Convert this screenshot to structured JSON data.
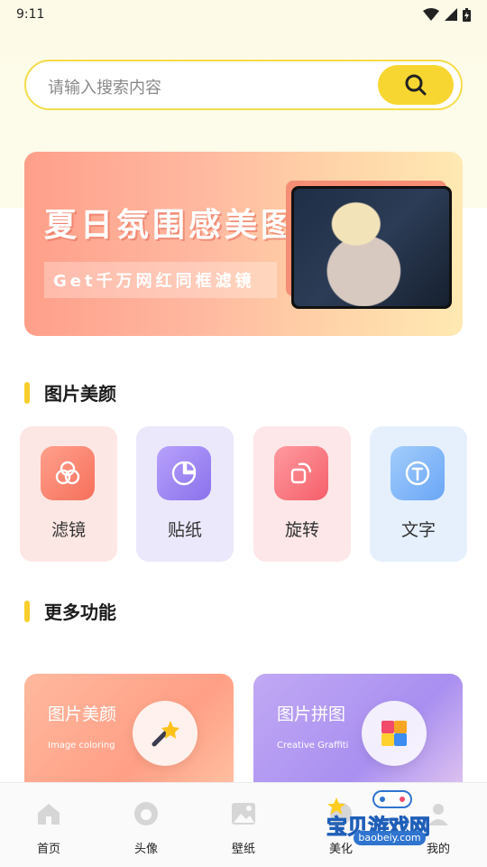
{
  "status_bar": {
    "time": "9:11"
  },
  "search": {
    "placeholder": "请输入搜索内容"
  },
  "banner": {
    "title": "夏日氛围感美图",
    "subtitle": "Get千万网红同框滤镜"
  },
  "sections": {
    "beauty_title": "图片美颜",
    "more_title": "更多功能"
  },
  "tools": [
    {
      "label": "滤镜",
      "icon": "filter-icon",
      "card_bg": "#fde7e4",
      "icon_color": "#f8836d"
    },
    {
      "label": "贴纸",
      "icon": "sticker-icon",
      "card_bg": "#ebe8fb",
      "icon_color": "#9a82f2"
    },
    {
      "label": "旋转",
      "icon": "rotate-icon",
      "card_bg": "#fde7e8",
      "icon_color": "#f9707a"
    },
    {
      "label": "文字",
      "icon": "text-icon",
      "card_bg": "#e6f0fd",
      "icon_color": "#7ab3f8"
    }
  ],
  "features": [
    {
      "title": "图片美颜",
      "subtitle": "Image coloring",
      "icon": "magic-wand-icon"
    },
    {
      "title": "图片拼图",
      "subtitle": "Creative Graffiti",
      "icon": "puzzle-icon"
    }
  ],
  "bottom_nav": [
    {
      "label": "首页",
      "icon": "home-icon"
    },
    {
      "label": "头像",
      "icon": "avatar-icon"
    },
    {
      "label": "壁纸",
      "icon": "wallpaper-icon"
    },
    {
      "label": "美化",
      "icon": "beautify-icon"
    },
    {
      "label": "我的",
      "icon": "profile-icon"
    }
  ],
  "watermark": {
    "text": "宝贝游戏网",
    "url": "baobeiy.com"
  },
  "colors": {
    "accent": "#f8d632",
    "search_border": "#f4dc49",
    "section_bar": "#f7cf2c"
  }
}
